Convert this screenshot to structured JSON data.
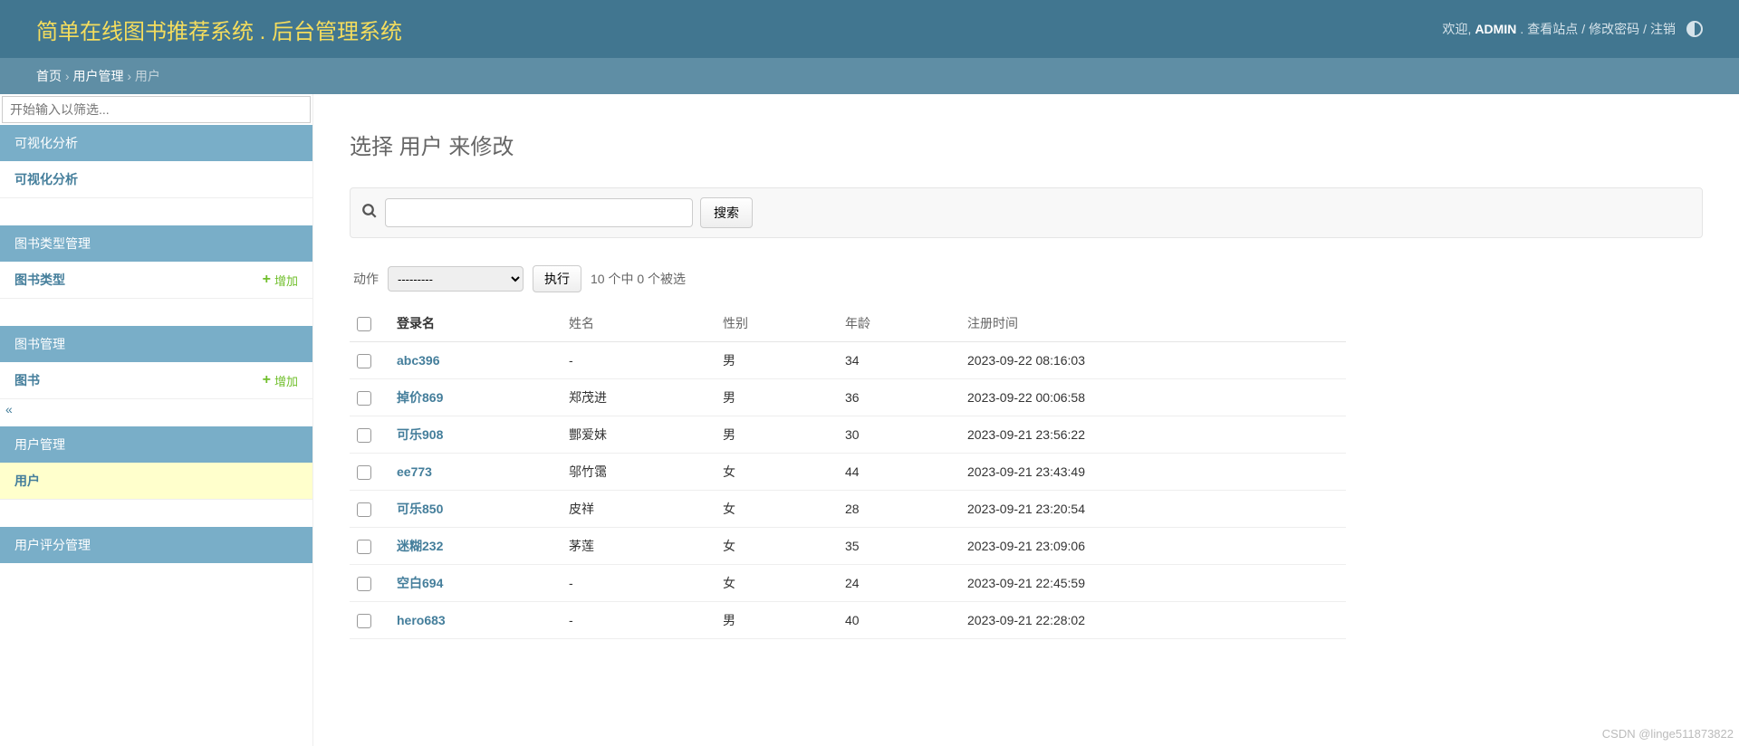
{
  "header": {
    "title": "简单在线图书推荐系统 . 后台管理系统",
    "welcome": "欢迎,",
    "user": "ADMIN",
    "view_site": "查看站点",
    "change_password": "修改密码",
    "logout": "注销",
    "sep": ".",
    "slash": " / "
  },
  "breadcrumbs": {
    "home": "首页",
    "app": "用户管理",
    "current": "用户",
    "arrow": " › "
  },
  "sidebar": {
    "filter_placeholder": "开始输入以筛选...",
    "modules": [
      {
        "caption": "可视化分析",
        "rows": [
          {
            "label": "可视化分析",
            "add": null,
            "active": false
          }
        ]
      },
      {
        "caption": "图书类型管理",
        "rows": [
          {
            "label": "图书类型",
            "add": "增加",
            "active": false
          }
        ]
      },
      {
        "caption": "图书管理",
        "rows": [
          {
            "label": "图书",
            "add": "增加",
            "active": false
          }
        ]
      },
      {
        "caption": "用户管理",
        "rows": [
          {
            "label": "用户",
            "add": null,
            "active": true
          }
        ]
      },
      {
        "caption": "用户评分管理",
        "rows": []
      }
    ]
  },
  "content": {
    "heading": "选择 用户 来修改",
    "search_button": "搜索",
    "actions": {
      "label": "动作",
      "placeholder": "---------",
      "go": "执行",
      "counter": "10 个中 0 个被选"
    },
    "table": {
      "columns": [
        "登录名",
        "姓名",
        "性别",
        "年龄",
        "注册时间"
      ],
      "rows": [
        {
          "login": "abc396",
          "name": "-",
          "gender": "男",
          "age": "34",
          "created": "2023-09-22 08:16:03"
        },
        {
          "login": "掉价869",
          "name": "郑茂进",
          "gender": "男",
          "age": "36",
          "created": "2023-09-22 00:06:58"
        },
        {
          "login": "可乐908",
          "name": "酆爱妹",
          "gender": "男",
          "age": "30",
          "created": "2023-09-21 23:56:22"
        },
        {
          "login": "ee773",
          "name": "邬竹霭",
          "gender": "女",
          "age": "44",
          "created": "2023-09-21 23:43:49"
        },
        {
          "login": "可乐850",
          "name": "皮祥",
          "gender": "女",
          "age": "28",
          "created": "2023-09-21 23:20:54"
        },
        {
          "login": "迷糊232",
          "name": "茅莲",
          "gender": "女",
          "age": "35",
          "created": "2023-09-21 23:09:06"
        },
        {
          "login": "空白694",
          "name": "-",
          "gender": "女",
          "age": "24",
          "created": "2023-09-21 22:45:59"
        },
        {
          "login": "hero683",
          "name": "-",
          "gender": "男",
          "age": "40",
          "created": "2023-09-21 22:28:02"
        }
      ]
    }
  },
  "watermark": "CSDN @linge511873822"
}
